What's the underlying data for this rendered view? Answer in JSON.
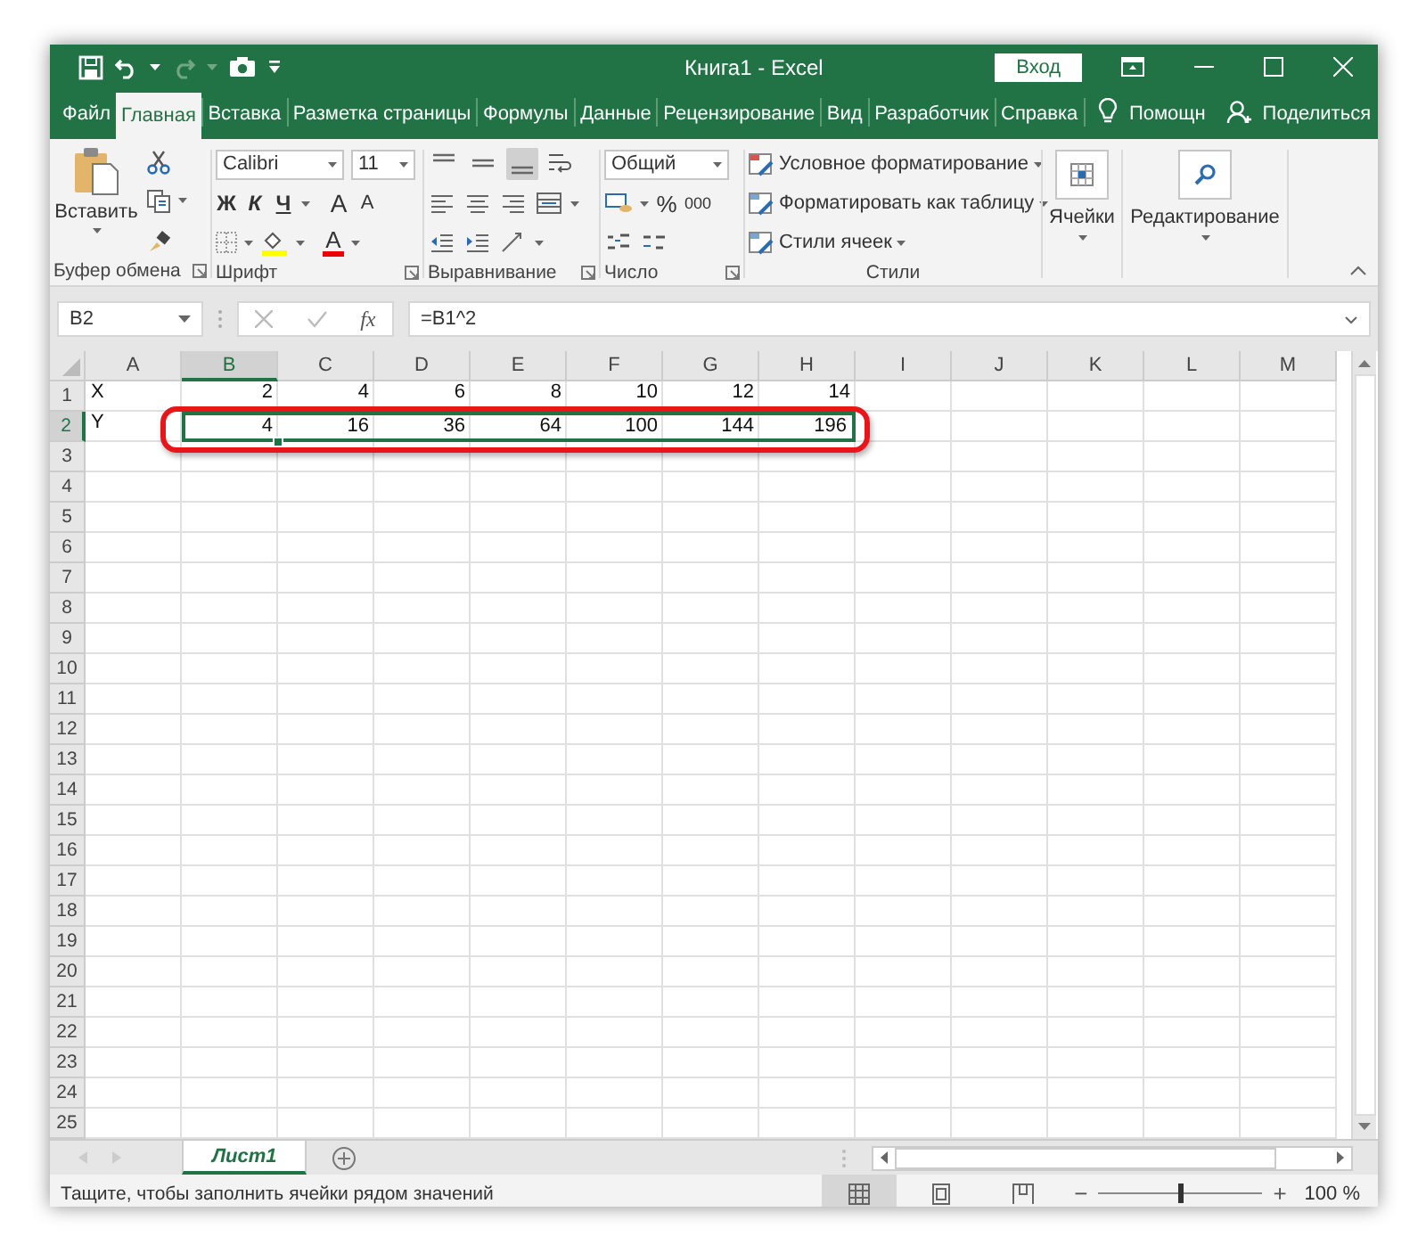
{
  "title_bar": {
    "title": "Книга1 - Excel",
    "sign_in": "Вход"
  },
  "tabs": [
    {
      "label": "Файл",
      "selected": false
    },
    {
      "label": "Главная",
      "selected": true
    },
    {
      "label": "Вставка",
      "selected": false
    },
    {
      "label": "Разметка страницы",
      "selected": false
    },
    {
      "label": "Формулы",
      "selected": false
    },
    {
      "label": "Данные",
      "selected": false
    },
    {
      "label": "Рецензирование",
      "selected": false
    },
    {
      "label": "Вид",
      "selected": false
    },
    {
      "label": "Разработчик",
      "selected": false
    },
    {
      "label": "Справка",
      "selected": false
    }
  ],
  "help": {
    "label": "Помощн"
  },
  "share": {
    "label": "Поделиться"
  },
  "ribbon": {
    "clipboard": {
      "paste": "Вставить",
      "label": "Буфер обмена"
    },
    "font": {
      "font_name": "Calibri",
      "font_size": "11",
      "bold": "Ж",
      "italic": "К",
      "underline": "Ч",
      "grow": "A",
      "shrink": "A",
      "font_color": "A",
      "label": "Шрифт"
    },
    "alignment": {
      "vertical": [
        {
          "kind": "top",
          "selected": false
        },
        {
          "kind": "middle",
          "selected": false
        },
        {
          "kind": "bottom",
          "selected": true
        }
      ],
      "label": "Выравнивание"
    },
    "number": {
      "format": "Общий",
      "percent": "%",
      "thousands": "000",
      "label": "Число"
    },
    "styles": {
      "items": [
        "Условное форматирование",
        "Форматировать как таблицу",
        "Стили ячеек"
      ],
      "label": "Стили"
    },
    "cells": {
      "label": "Ячейки"
    },
    "editing": {
      "label": "Редактирование"
    }
  },
  "formula_bar": {
    "name_box": "B2",
    "function_label": "fx",
    "formula": "=B1^2"
  },
  "grid": {
    "columns": [
      {
        "label": "A",
        "selected": false
      },
      {
        "label": "B",
        "selected": true
      },
      {
        "label": "C",
        "selected": false
      },
      {
        "label": "D",
        "selected": false
      },
      {
        "label": "E",
        "selected": false
      },
      {
        "label": "F",
        "selected": false
      },
      {
        "label": "G",
        "selected": false
      },
      {
        "label": "H",
        "selected": false
      },
      {
        "label": "I",
        "selected": false
      },
      {
        "label": "J",
        "selected": false
      },
      {
        "label": "K",
        "selected": false
      },
      {
        "label": "L",
        "selected": false
      },
      {
        "label": "M",
        "selected": false
      }
    ],
    "rows": [
      {
        "number": "1",
        "selected": false,
        "cells": [
          {
            "text": "X",
            "in_range": false
          },
          {
            "text": "2",
            "in_range": false
          },
          {
            "text": "4",
            "in_range": false
          },
          {
            "text": "6",
            "in_range": false
          },
          {
            "text": "8",
            "in_range": false
          },
          {
            "text": "10",
            "in_range": false
          },
          {
            "text": "12",
            "in_range": false
          },
          {
            "text": "14",
            "in_range": false
          }
        ]
      },
      {
        "number": "2",
        "selected": true,
        "cells": [
          {
            "text": "Y",
            "in_range": false
          },
          {
            "text": "4",
            "in_range": true
          },
          {
            "text": "16",
            "in_range": true
          },
          {
            "text": "36",
            "in_range": true
          },
          {
            "text": "64",
            "in_range": true
          },
          {
            "text": "100",
            "in_range": true
          },
          {
            "text": "144",
            "in_range": true
          },
          {
            "text": "196",
            "in_range": true
          }
        ]
      },
      {
        "number": "3",
        "selected": false
      },
      {
        "number": "4",
        "selected": false
      },
      {
        "number": "5",
        "selected": false
      },
      {
        "number": "6",
        "selected": false
      },
      {
        "number": "7",
        "selected": false
      },
      {
        "number": "8",
        "selected": false
      },
      {
        "number": "9",
        "selected": false
      },
      {
        "number": "10",
        "selected": false
      },
      {
        "number": "11",
        "selected": false
      },
      {
        "number": "12",
        "selected": false
      },
      {
        "number": "13",
        "selected": false
      },
      {
        "number": "14",
        "selected": false
      },
      {
        "number": "15",
        "selected": false
      },
      {
        "number": "16",
        "selected": false
      },
      {
        "number": "17",
        "selected": false
      },
      {
        "number": "18",
        "selected": false
      },
      {
        "number": "19",
        "selected": false
      },
      {
        "number": "20",
        "selected": false
      },
      {
        "number": "21",
        "selected": false
      },
      {
        "number": "22",
        "selected": false
      },
      {
        "number": "23",
        "selected": false
      },
      {
        "number": "24",
        "selected": false
      },
      {
        "number": "25",
        "selected": false
      }
    ]
  },
  "annotation_outline": true,
  "sheet_tabs": [
    {
      "label": "Лист1",
      "selected": true
    }
  ],
  "status_bar": {
    "message": "Тащите, чтобы заполнить ячейки рядом значений",
    "views": [
      {
        "kind": "normal",
        "selected": true
      },
      {
        "kind": "page_layout",
        "selected": false
      },
      {
        "kind": "page_break",
        "selected": false
      }
    ],
    "zoom": {
      "minus": "−",
      "level": 0.5,
      "plus": "+",
      "reading": "100 %"
    }
  }
}
